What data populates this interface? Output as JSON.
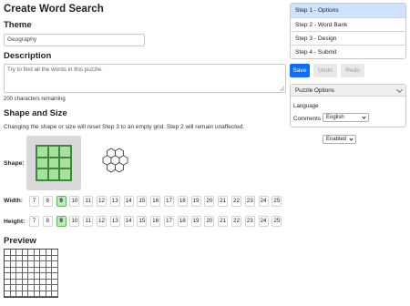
{
  "page": {
    "title": "Create Word Search",
    "theme_heading": "Theme",
    "theme_value": "Geography",
    "description_heading": "Description",
    "description_placeholder": "Try to find all the words in this puzzle.",
    "chars_remaining": "200 characters remaining",
    "shape_heading": "Shape and Size",
    "shape_info": "Changing the shape or size will reset Step 3 to an empty grid. Step 2 will remain unaffected.",
    "shape_label": "Shape:",
    "width_label": "Width:",
    "height_label": "Height:",
    "preview_heading": "Preview",
    "size_options": [
      "7",
      "8",
      "9",
      "10",
      "11",
      "12",
      "13",
      "14",
      "15",
      "16",
      "17",
      "18",
      "19",
      "20",
      "21",
      "22",
      "23",
      "24",
      "25"
    ],
    "selected_width": "9",
    "selected_height": "9"
  },
  "steps": [
    {
      "label": "Step 1 - Options",
      "active": true
    },
    {
      "label": "Step 2 - Word Bank",
      "active": false
    },
    {
      "label": "Step 3 - Design",
      "active": false
    },
    {
      "label": "Step 4 - Submit",
      "active": false
    }
  ],
  "buttons": {
    "save": "Save",
    "undo": "Undo",
    "redo": "Redo"
  },
  "options_panel": {
    "title": "Puzzle Options",
    "language_label": "Language",
    "language_value": "English",
    "comments_label": "Comments",
    "comments_value": "Enabled"
  },
  "colors": {
    "accent": "#0d6efd",
    "active_step": "#cfe2ff",
    "selected_size": "#bfe8bf",
    "grid_green": "#a8e0a0"
  }
}
